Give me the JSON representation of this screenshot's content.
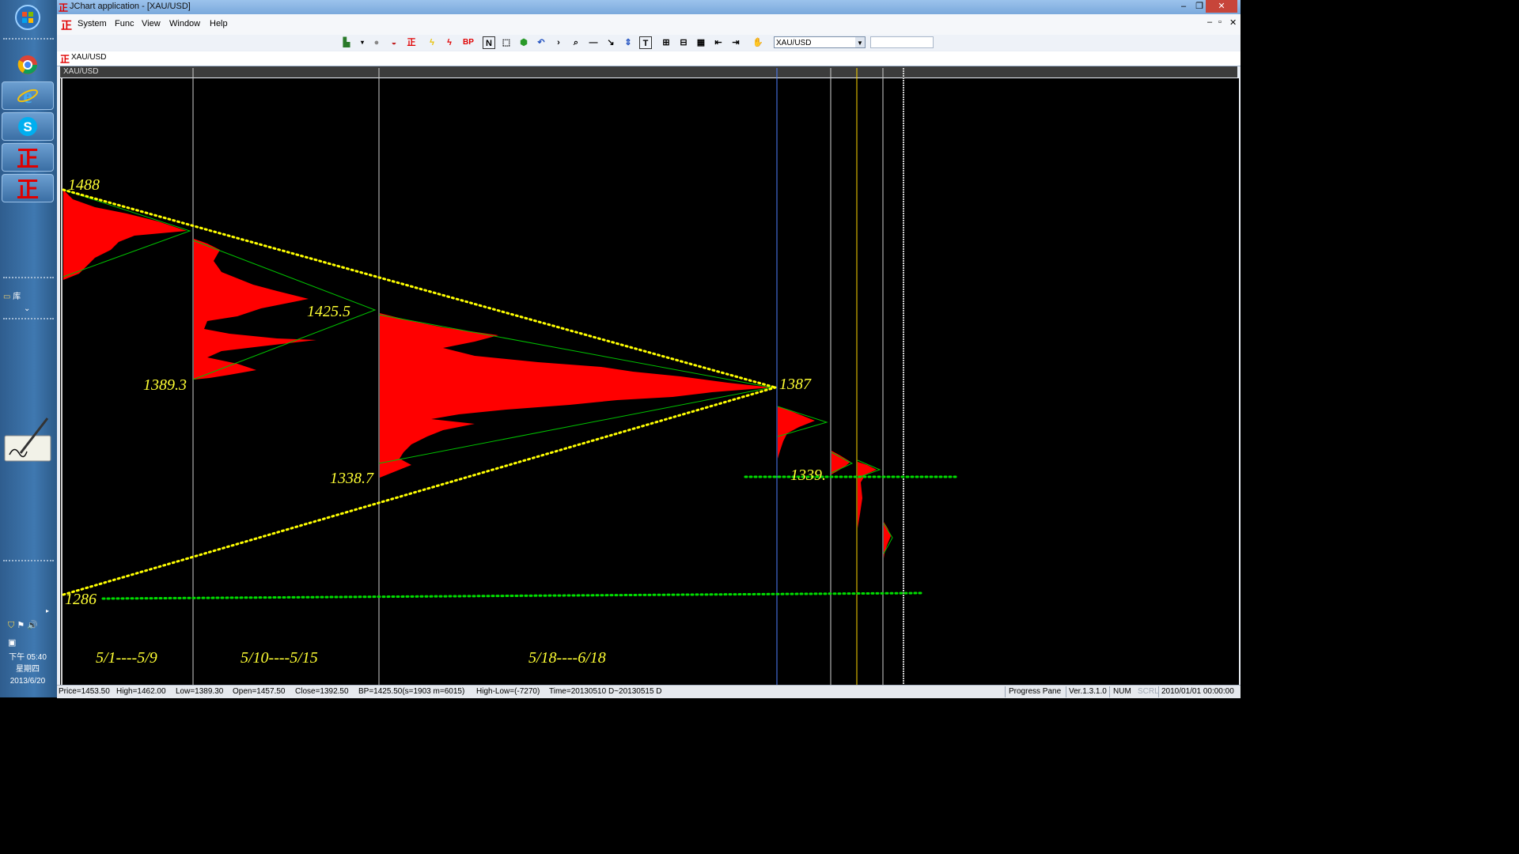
{
  "window": {
    "title": "JChart application - [XAU/USD]",
    "controls": {
      "minimize": "–",
      "restore": "❐",
      "close": "✕"
    },
    "mdi_controls": {
      "minimize": "–",
      "restore": "▫",
      "close": "✕"
    }
  },
  "menu": [
    "System",
    "Func",
    "View",
    "Window",
    "Help"
  ],
  "toolbar": {
    "symbol": "XAU/USD",
    "bp_label": "BP",
    "n_label": "N",
    "t_label": "T"
  },
  "tab": {
    "label": "XAU/USD"
  },
  "chart_header": "XAU/USD",
  "chart_labels": {
    "p1488": "1488",
    "p1425": "1425.5",
    "p1389": "1389.3",
    "p1387": "1387",
    "p1338": "1338.7",
    "p1339": "1339.",
    "p1286": "1286",
    "range1": "5/1----5/9",
    "range2": "5/10----5/15",
    "range3": "5/18----6/18"
  },
  "taskbar": {
    "library_label": "库",
    "time": "下午 05:40",
    "weekday": "星期四",
    "date": "2013/6/20"
  },
  "status": {
    "price": "Price=1453.50",
    "high": "High=1462.00",
    "low": "Low=1389.30",
    "open": "Open=1457.50",
    "close": "Close=1392.50",
    "bp": "BP=1425.50(s=1903 m=6015)",
    "highlow": "High-Low=(-7270)",
    "time": "Time=20130510 D~20130515 D",
    "pane": "Progress Pane",
    "version": "Ver.1.3.1.0",
    "num": "NUM",
    "scrl": "SCRL",
    "datetime": "2010/01/01 00:00:00"
  },
  "colors": {
    "profile": "#ff0000",
    "trend_dots": "#ffff00",
    "support_dots": "#00cc00",
    "green_line": "#00c000",
    "label": "#ffff33"
  }
}
